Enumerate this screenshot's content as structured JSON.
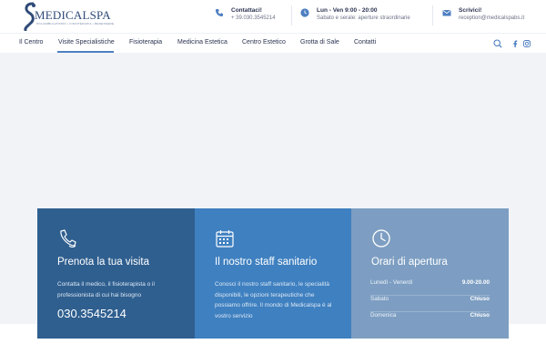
{
  "brand": {
    "name": "MEDICALSPA",
    "tagline": "POLIAMBULATORIO • FISIOTERAPIA • BENESSERE"
  },
  "contacts": [
    {
      "title": "Contattaci!",
      "detail": "+ 39.030.3545214",
      "icon": "phone-icon"
    },
    {
      "title": "Lun - Ven 9:00 - 20:00",
      "detail": "Sabato e serale: aperture straordinarie",
      "icon": "clock-icon"
    },
    {
      "title": "Scrivici!",
      "detail": "reception@medicalspabs.it",
      "icon": "mail-icon"
    }
  ],
  "nav": {
    "items": [
      "Il Centro",
      "Visite Specialistiche",
      "Fisioterapia",
      "Medicina Estetica",
      "Centro Estetico",
      "Grotta di Sale",
      "Contatti"
    ],
    "active_index": 1
  },
  "cards": {
    "booking": {
      "title": "Prenota la tua visita",
      "text": "Contatta il medico, il fisioterapista o il professionista di cui hai bisogno",
      "phone": "030.3545214",
      "icon": "phone-hand-icon"
    },
    "staff": {
      "title": "Il nostro staff sanitario",
      "text": "Conosci il nostro staff sanitario, le specialità disponibili, le opzioni terapeutiche che possiamo offrire. Il mondo di Medicalspa è al vostro servizio",
      "icon": "calendar-icon"
    },
    "hours": {
      "title": "Orari di apertura",
      "icon": "clock-outline-icon",
      "rows": [
        {
          "day": "Lunedì - Venerdì",
          "time": "9.00-20.00"
        },
        {
          "day": "Sabato",
          "time": "Chiuso"
        },
        {
          "day": "Domenica",
          "time": "Chiuso"
        }
      ]
    }
  },
  "colors": {
    "card_booking": "#2f5f8f",
    "card_staff": "#3f80c0",
    "card_hours": "#7d9ec2",
    "accent": "#4d7fc1",
    "hero_bg": "#f2f3f7"
  }
}
